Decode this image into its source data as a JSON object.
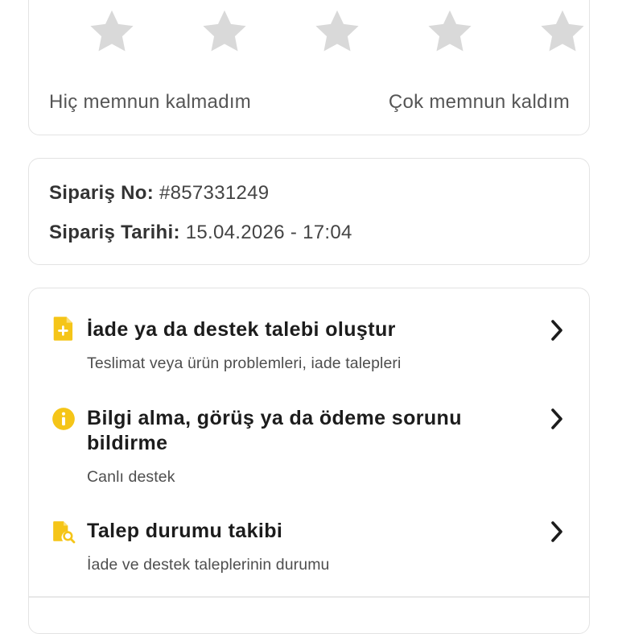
{
  "colors": {
    "accent": "#F5C518",
    "star_empty": "#D9D9D9",
    "text_primary": "#1C1C1C",
    "text_secondary": "#4E4E4E",
    "border": "#E3E3E3"
  },
  "rating": {
    "stars_total": 5,
    "stars_selected": 0,
    "low_label": "Hiç memnun kalmadım",
    "high_label": "Çok memnun kaldım"
  },
  "order": {
    "number_label": "Sipariş No:",
    "number_value": "#857331249",
    "date_label": "Sipariş Tarihi:",
    "date_value": "15.04.2026 - 17:04"
  },
  "actions": [
    {
      "icon": "document-add-icon",
      "title": "İade ya da destek talebi oluştur",
      "subtitle": "Teslimat veya ürün problemleri, iade talepleri"
    },
    {
      "icon": "info-icon",
      "title": "Bilgi alma, görüş ya da ödeme sorunu bildirme",
      "subtitle": "Canlı destek"
    },
    {
      "icon": "document-search-icon",
      "title": "Talep durumu takibi",
      "subtitle": "İade ve destek taleplerinin durumu"
    }
  ]
}
